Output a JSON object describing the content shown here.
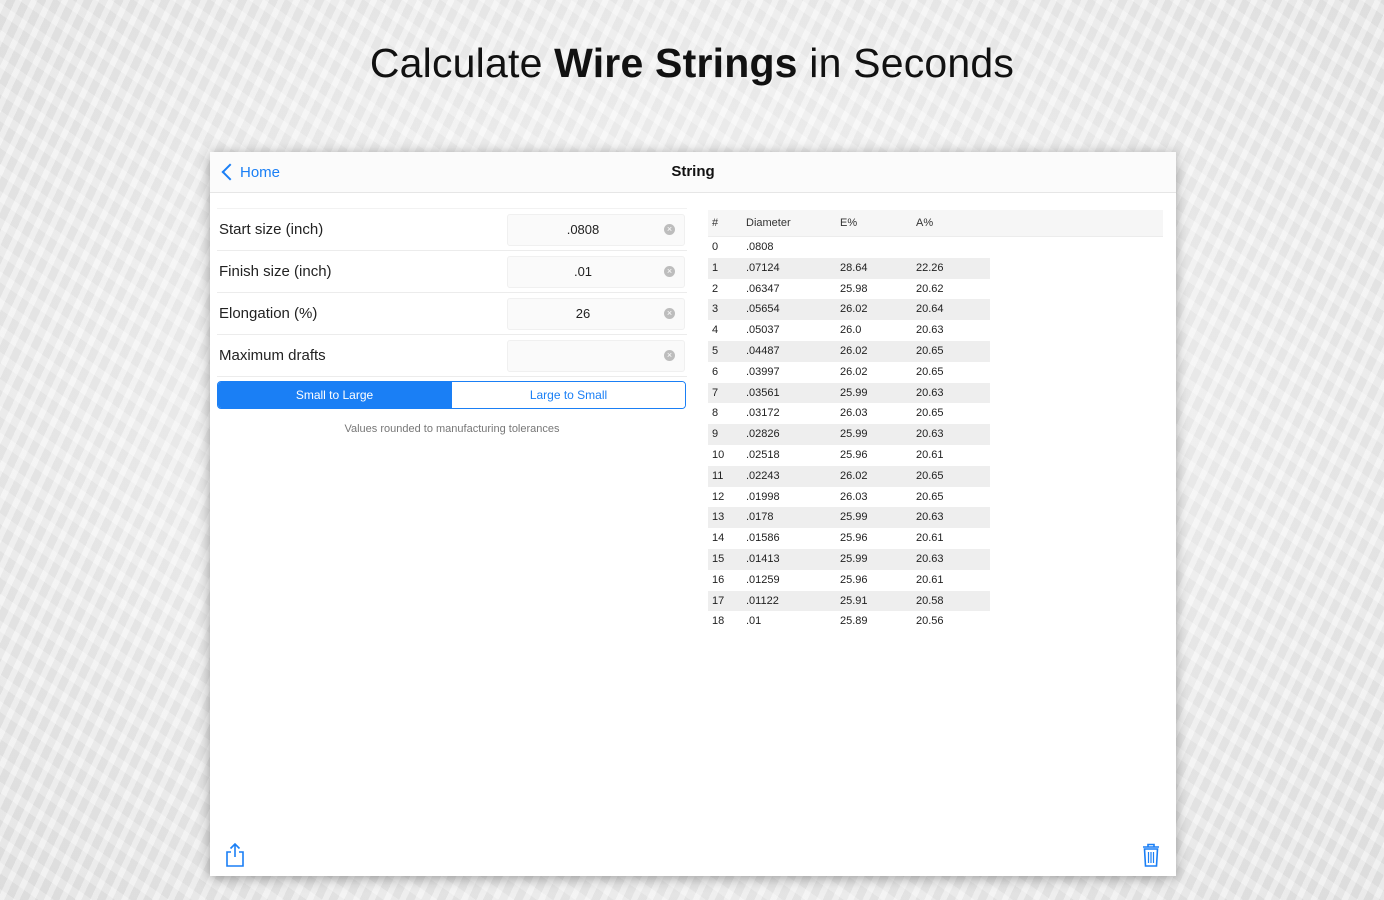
{
  "headline": {
    "part1": "Calculate ",
    "bold": "Wire Strings",
    "part2": " in Seconds"
  },
  "navbar": {
    "back_label": "Home",
    "title": "String"
  },
  "form": {
    "fields": [
      {
        "label": "Start size (inch)",
        "value": ".0808"
      },
      {
        "label": "Finish size (inch)",
        "value": ".01"
      },
      {
        "label": "Elongation (%)",
        "value": "26"
      },
      {
        "label": "Maximum drafts",
        "value": ""
      }
    ],
    "segment": {
      "selected": "Small to Large",
      "other": "Large to Small"
    },
    "note": "Values rounded to manufacturing tolerances"
  },
  "table": {
    "headers": [
      "#",
      "Diameter",
      "E%",
      "A%"
    ],
    "rows": [
      [
        "0",
        ".0808",
        "",
        ""
      ],
      [
        "1",
        ".07124",
        "28.64",
        "22.26"
      ],
      [
        "2",
        ".06347",
        "25.98",
        "20.62"
      ],
      [
        "3",
        ".05654",
        "26.02",
        "20.64"
      ],
      [
        "4",
        ".05037",
        "26.0",
        "20.63"
      ],
      [
        "5",
        ".04487",
        "26.02",
        "20.65"
      ],
      [
        "6",
        ".03997",
        "26.02",
        "20.65"
      ],
      [
        "7",
        ".03561",
        "25.99",
        "20.63"
      ],
      [
        "8",
        ".03172",
        "26.03",
        "20.65"
      ],
      [
        "9",
        ".02826",
        "25.99",
        "20.63"
      ],
      [
        "10",
        ".02518",
        "25.96",
        "20.61"
      ],
      [
        "11",
        ".02243",
        "26.02",
        "20.65"
      ],
      [
        "12",
        ".01998",
        "26.03",
        "20.65"
      ],
      [
        "13",
        ".0178",
        "25.99",
        "20.63"
      ],
      [
        "14",
        ".01586",
        "25.96",
        "20.61"
      ],
      [
        "15",
        ".01413",
        "25.99",
        "20.63"
      ],
      [
        "16",
        ".01259",
        "25.96",
        "20.61"
      ],
      [
        "17",
        ".01122",
        "25.91",
        "20.58"
      ],
      [
        "18",
        ".01",
        "25.89",
        "20.56"
      ]
    ]
  },
  "icons": {
    "share": "share-icon",
    "trash": "trash-icon",
    "clear": "clear-icon"
  },
  "colors": {
    "accent": "#1a7ff5"
  }
}
